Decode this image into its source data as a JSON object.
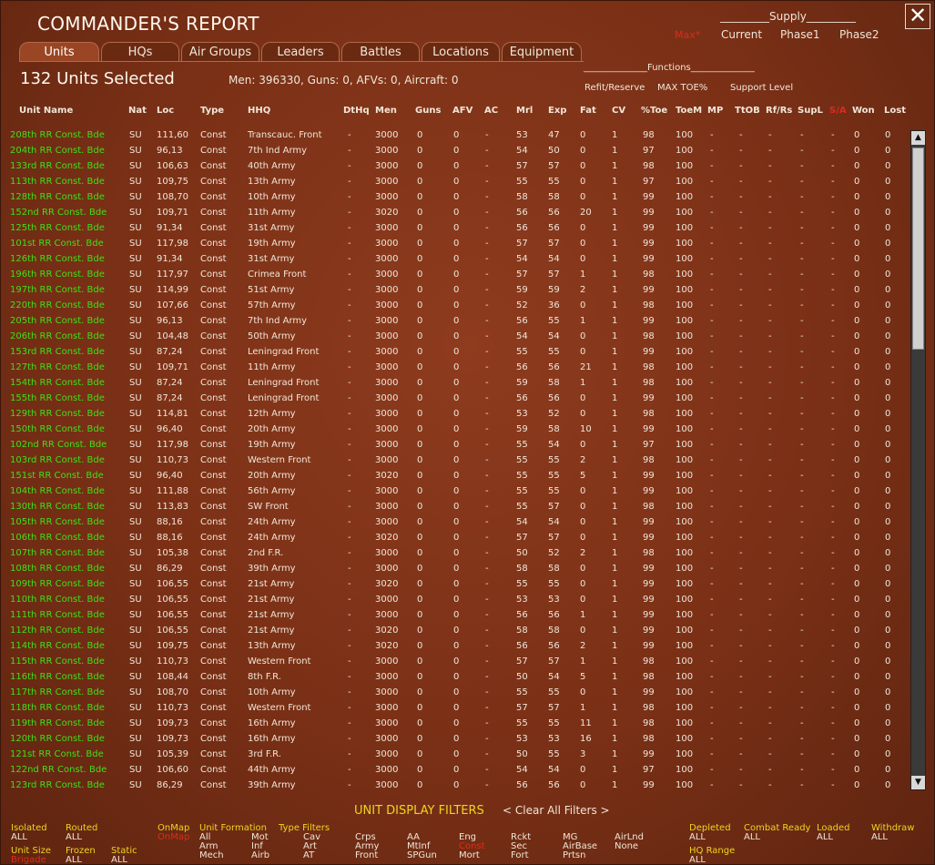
{
  "window": {
    "title": "COMMANDER'S REPORT",
    "close_glyph": "✕",
    "max_label": "Max*"
  },
  "supply": {
    "header": "_________Supply_________",
    "options": [
      "Current",
      "Phase1",
      "Phase2"
    ]
  },
  "tabs": [
    "Units",
    "HQs",
    "Air Groups",
    "Leaders",
    "Battles",
    "Locations",
    "Equipment"
  ],
  "active_tab": "Units",
  "summary": {
    "units_selected": "132 Units Selected",
    "totals": "Men: 396330, Guns: 0, AFVs: 0, Aircraft: 0"
  },
  "functions": {
    "header": "______________Functions______________",
    "options": [
      "Refit/Reserve",
      "MAX TOE%",
      "Support Level"
    ]
  },
  "columns": [
    "Unit Name",
    "Nat",
    "Loc",
    "Type",
    "HHQ",
    "DtHq",
    "Men",
    "Guns",
    "AFV",
    "AC",
    "Mrl",
    "Exp",
    "Fat",
    "CV",
    "%Toe",
    "ToeM",
    "MP",
    "TtOB",
    "Rf/Rs",
    "SupL",
    "S/A",
    "Won",
    "Lost"
  ],
  "rows": [
    [
      "208th RR Const. Bde",
      "SU",
      "111,60",
      "Const",
      "Transcauc. Front",
      "-",
      "3000",
      "0",
      "0",
      "-",
      "53",
      "47",
      "0",
      "1",
      "98",
      "100",
      "-",
      "-",
      "-",
      "-",
      "-",
      "0",
      "0"
    ],
    [
      "204th RR Const. Bde",
      "SU",
      "96,13",
      "Const",
      "7th Ind Army",
      "-",
      "3000",
      "0",
      "0",
      "-",
      "54",
      "50",
      "0",
      "1",
      "97",
      "100",
      "-",
      "-",
      "-",
      "-",
      "-",
      "0",
      "0"
    ],
    [
      "133rd RR Const. Bde",
      "SU",
      "106,63",
      "Const",
      "40th Army",
      "-",
      "3000",
      "0",
      "0",
      "-",
      "57",
      "57",
      "0",
      "1",
      "98",
      "100",
      "-",
      "-",
      "-",
      "-",
      "-",
      "0",
      "0"
    ],
    [
      "113th RR Const. Bde",
      "SU",
      "109,75",
      "Const",
      "13th Army",
      "-",
      "3000",
      "0",
      "0",
      "-",
      "55",
      "55",
      "0",
      "1",
      "97",
      "100",
      "-",
      "-",
      "-",
      "-",
      "-",
      "0",
      "0"
    ],
    [
      "128th RR Const. Bde",
      "SU",
      "108,70",
      "Const",
      "10th Army",
      "-",
      "3000",
      "0",
      "0",
      "-",
      "58",
      "58",
      "0",
      "1",
      "99",
      "100",
      "-",
      "-",
      "-",
      "-",
      "-",
      "0",
      "0"
    ],
    [
      "152nd RR Const. Bde",
      "SU",
      "109,71",
      "Const",
      "11th Army",
      "-",
      "3020",
      "0",
      "0",
      "-",
      "56",
      "56",
      "20",
      "1",
      "99",
      "100",
      "-",
      "-",
      "-",
      "-",
      "-",
      "0",
      "0"
    ],
    [
      "125th RR Const. Bde",
      "SU",
      "91,34",
      "Const",
      "31st Army",
      "-",
      "3000",
      "0",
      "0",
      "-",
      "56",
      "56",
      "0",
      "1",
      "99",
      "100",
      "-",
      "-",
      "-",
      "-",
      "-",
      "0",
      "0"
    ],
    [
      "101st RR Const. Bde",
      "SU",
      "117,98",
      "Const",
      "19th Army",
      "-",
      "3000",
      "0",
      "0",
      "-",
      "57",
      "57",
      "0",
      "1",
      "99",
      "100",
      "-",
      "-",
      "-",
      "-",
      "-",
      "0",
      "0"
    ],
    [
      "126th RR Const. Bde",
      "SU",
      "91,34",
      "Const",
      "31st Army",
      "-",
      "3000",
      "0",
      "0",
      "-",
      "54",
      "54",
      "0",
      "1",
      "99",
      "100",
      "-",
      "-",
      "-",
      "-",
      "-",
      "0",
      "0"
    ],
    [
      "196th RR Const. Bde",
      "SU",
      "117,97",
      "Const",
      "Crimea Front",
      "-",
      "3000",
      "0",
      "0",
      "-",
      "57",
      "57",
      "1",
      "1",
      "98",
      "100",
      "-",
      "-",
      "-",
      "-",
      "-",
      "0",
      "0"
    ],
    [
      "197th RR Const. Bde",
      "SU",
      "114,99",
      "Const",
      "51st Army",
      "-",
      "3000",
      "0",
      "0",
      "-",
      "59",
      "59",
      "2",
      "1",
      "99",
      "100",
      "-",
      "-",
      "-",
      "-",
      "-",
      "0",
      "0"
    ],
    [
      "220th RR Const. Bde",
      "SU",
      "107,66",
      "Const",
      "57th Army",
      "-",
      "3000",
      "0",
      "0",
      "-",
      "52",
      "36",
      "0",
      "1",
      "98",
      "100",
      "-",
      "-",
      "-",
      "-",
      "-",
      "0",
      "0"
    ],
    [
      "205th RR Const. Bde",
      "SU",
      "96,13",
      "Const",
      "7th Ind Army",
      "-",
      "3000",
      "0",
      "0",
      "-",
      "56",
      "55",
      "1",
      "1",
      "99",
      "100",
      "-",
      "-",
      "-",
      "-",
      "-",
      "0",
      "0"
    ],
    [
      "206th RR Const. Bde",
      "SU",
      "104,48",
      "Const",
      "50th Army",
      "-",
      "3000",
      "0",
      "0",
      "-",
      "54",
      "54",
      "0",
      "1",
      "98",
      "100",
      "-",
      "-",
      "-",
      "-",
      "-",
      "0",
      "0"
    ],
    [
      "153rd RR Const. Bde",
      "SU",
      "87,24",
      "Const",
      "Leningrad Front",
      "-",
      "3000",
      "0",
      "0",
      "-",
      "55",
      "55",
      "0",
      "1",
      "99",
      "100",
      "-",
      "-",
      "-",
      "-",
      "-",
      "0",
      "0"
    ],
    [
      "127th RR Const. Bde",
      "SU",
      "109,71",
      "Const",
      "11th Army",
      "-",
      "3000",
      "0",
      "0",
      "-",
      "56",
      "56",
      "21",
      "1",
      "98",
      "100",
      "-",
      "-",
      "-",
      "-",
      "-",
      "0",
      "0"
    ],
    [
      "154th RR Const. Bde",
      "SU",
      "87,24",
      "Const",
      "Leningrad Front",
      "-",
      "3000",
      "0",
      "0",
      "-",
      "59",
      "58",
      "1",
      "1",
      "98",
      "100",
      "-",
      "-",
      "-",
      "-",
      "-",
      "0",
      "0"
    ],
    [
      "155th RR Const. Bde",
      "SU",
      "87,24",
      "Const",
      "Leningrad Front",
      "-",
      "3000",
      "0",
      "0",
      "-",
      "56",
      "56",
      "0",
      "1",
      "99",
      "100",
      "-",
      "-",
      "-",
      "-",
      "-",
      "0",
      "0"
    ],
    [
      "129th RR Const. Bde",
      "SU",
      "114,81",
      "Const",
      "12th Army",
      "-",
      "3000",
      "0",
      "0",
      "-",
      "53",
      "52",
      "0",
      "1",
      "98",
      "100",
      "-",
      "-",
      "-",
      "-",
      "-",
      "0",
      "0"
    ],
    [
      "150th RR Const. Bde",
      "SU",
      "96,40",
      "Const",
      "20th Army",
      "-",
      "3000",
      "0",
      "0",
      "-",
      "59",
      "58",
      "10",
      "1",
      "99",
      "100",
      "-",
      "-",
      "-",
      "-",
      "-",
      "0",
      "0"
    ],
    [
      "102nd RR Const. Bde",
      "SU",
      "117,98",
      "Const",
      "19th Army",
      "-",
      "3000",
      "0",
      "0",
      "-",
      "55",
      "54",
      "0",
      "1",
      "97",
      "100",
      "-",
      "-",
      "-",
      "-",
      "-",
      "0",
      "0"
    ],
    [
      "103rd RR Const. Bde",
      "SU",
      "110,73",
      "Const",
      "Western Front",
      "-",
      "3000",
      "0",
      "0",
      "-",
      "55",
      "55",
      "2",
      "1",
      "98",
      "100",
      "-",
      "-",
      "-",
      "-",
      "-",
      "0",
      "0"
    ],
    [
      "151st RR Const. Bde",
      "SU",
      "96,40",
      "Const",
      "20th Army",
      "-",
      "3020",
      "0",
      "0",
      "-",
      "55",
      "55",
      "5",
      "1",
      "99",
      "100",
      "-",
      "-",
      "-",
      "-",
      "-",
      "0",
      "0"
    ],
    [
      "104th RR Const. Bde",
      "SU",
      "111,88",
      "Const",
      "56th Army",
      "-",
      "3000",
      "0",
      "0",
      "-",
      "55",
      "55",
      "0",
      "1",
      "99",
      "100",
      "-",
      "-",
      "-",
      "-",
      "-",
      "0",
      "0"
    ],
    [
      "130th RR Const. Bde",
      "SU",
      "113,83",
      "Const",
      "SW Front",
      "-",
      "3000",
      "0",
      "0",
      "-",
      "55",
      "57",
      "0",
      "1",
      "98",
      "100",
      "-",
      "-",
      "-",
      "-",
      "-",
      "0",
      "0"
    ],
    [
      "105th RR Const. Bde",
      "SU",
      "88,16",
      "Const",
      "24th Army",
      "-",
      "3000",
      "0",
      "0",
      "-",
      "54",
      "54",
      "0",
      "1",
      "99",
      "100",
      "-",
      "-",
      "-",
      "-",
      "-",
      "0",
      "0"
    ],
    [
      "106th RR Const. Bde",
      "SU",
      "88,16",
      "Const",
      "24th Army",
      "-",
      "3020",
      "0",
      "0",
      "-",
      "57",
      "57",
      "0",
      "1",
      "99",
      "100",
      "-",
      "-",
      "-",
      "-",
      "-",
      "0",
      "0"
    ],
    [
      "107th RR Const. Bde",
      "SU",
      "105,38",
      "Const",
      "2nd F.R.",
      "-",
      "3000",
      "0",
      "0",
      "-",
      "50",
      "52",
      "2",
      "1",
      "98",
      "100",
      "-",
      "-",
      "-",
      "-",
      "-",
      "0",
      "0"
    ],
    [
      "108th RR Const. Bde",
      "SU",
      "86,29",
      "Const",
      "39th Army",
      "-",
      "3000",
      "0",
      "0",
      "-",
      "58",
      "58",
      "0",
      "1",
      "99",
      "100",
      "-",
      "-",
      "-",
      "-",
      "-",
      "0",
      "0"
    ],
    [
      "109th RR Const. Bde",
      "SU",
      "106,55",
      "Const",
      "21st Army",
      "-",
      "3020",
      "0",
      "0",
      "-",
      "55",
      "55",
      "0",
      "1",
      "99",
      "100",
      "-",
      "-",
      "-",
      "-",
      "-",
      "0",
      "0"
    ],
    [
      "110th RR Const. Bde",
      "SU",
      "106,55",
      "Const",
      "21st Army",
      "-",
      "3000",
      "0",
      "0",
      "-",
      "53",
      "53",
      "0",
      "1",
      "99",
      "100",
      "-",
      "-",
      "-",
      "-",
      "-",
      "0",
      "0"
    ],
    [
      "111th RR Const. Bde",
      "SU",
      "106,55",
      "Const",
      "21st Army",
      "-",
      "3000",
      "0",
      "0",
      "-",
      "56",
      "56",
      "1",
      "1",
      "99",
      "100",
      "-",
      "-",
      "-",
      "-",
      "-",
      "0",
      "0"
    ],
    [
      "112th RR Const. Bde",
      "SU",
      "106,55",
      "Const",
      "21st Army",
      "-",
      "3020",
      "0",
      "0",
      "-",
      "58",
      "58",
      "0",
      "1",
      "99",
      "100",
      "-",
      "-",
      "-",
      "-",
      "-",
      "0",
      "0"
    ],
    [
      "114th RR Const. Bde",
      "SU",
      "109,75",
      "Const",
      "13th Army",
      "-",
      "3020",
      "0",
      "0",
      "-",
      "56",
      "56",
      "2",
      "1",
      "99",
      "100",
      "-",
      "-",
      "-",
      "-",
      "-",
      "0",
      "0"
    ],
    [
      "115th RR Const. Bde",
      "SU",
      "110,73",
      "Const",
      "Western Front",
      "-",
      "3000",
      "0",
      "0",
      "-",
      "57",
      "57",
      "1",
      "1",
      "98",
      "100",
      "-",
      "-",
      "-",
      "-",
      "-",
      "0",
      "0"
    ],
    [
      "116th RR Const. Bde",
      "SU",
      "108,44",
      "Const",
      "8th F.R.",
      "-",
      "3000",
      "0",
      "0",
      "-",
      "50",
      "54",
      "5",
      "1",
      "98",
      "100",
      "-",
      "-",
      "-",
      "-",
      "-",
      "0",
      "0"
    ],
    [
      "117th RR Const. Bde",
      "SU",
      "108,70",
      "Const",
      "10th Army",
      "-",
      "3000",
      "0",
      "0",
      "-",
      "55",
      "55",
      "0",
      "1",
      "99",
      "100",
      "-",
      "-",
      "-",
      "-",
      "-",
      "0",
      "0"
    ],
    [
      "118th RR Const. Bde",
      "SU",
      "110,73",
      "Const",
      "Western Front",
      "-",
      "3000",
      "0",
      "0",
      "-",
      "57",
      "57",
      "1",
      "1",
      "98",
      "100",
      "-",
      "-",
      "-",
      "-",
      "-",
      "0",
      "0"
    ],
    [
      "119th RR Const. Bde",
      "SU",
      "109,73",
      "Const",
      "16th Army",
      "-",
      "3000",
      "0",
      "0",
      "-",
      "55",
      "55",
      "11",
      "1",
      "98",
      "100",
      "-",
      "-",
      "-",
      "-",
      "-",
      "0",
      "0"
    ],
    [
      "120th RR Const. Bde",
      "SU",
      "109,73",
      "Const",
      "16th Army",
      "-",
      "3000",
      "0",
      "0",
      "-",
      "53",
      "53",
      "16",
      "1",
      "98",
      "100",
      "-",
      "-",
      "-",
      "-",
      "-",
      "0",
      "0"
    ],
    [
      "121st RR Const. Bde",
      "SU",
      "105,39",
      "Const",
      "3rd F.R.",
      "-",
      "3000",
      "0",
      "0",
      "-",
      "50",
      "55",
      "3",
      "1",
      "99",
      "100",
      "-",
      "-",
      "-",
      "-",
      "-",
      "0",
      "0"
    ],
    [
      "122nd RR Const. Bde",
      "SU",
      "106,60",
      "Const",
      "44th Army",
      "-",
      "3000",
      "0",
      "0",
      "-",
      "54",
      "54",
      "0",
      "1",
      "97",
      "100",
      "-",
      "-",
      "-",
      "-",
      "-",
      "0",
      "0"
    ],
    [
      "123rd RR Const. Bde",
      "SU",
      "86,29",
      "Const",
      "39th Army",
      "-",
      "3000",
      "0",
      "0",
      "-",
      "56",
      "56",
      "0",
      "1",
      "99",
      "100",
      "-",
      "-",
      "-",
      "-",
      "-",
      "0",
      "0"
    ]
  ],
  "filters": {
    "title": "UNIT DISPLAY FILTERS",
    "clear": "< Clear All Filters >",
    "items": [
      {
        "t": "Isolated",
        "c": "y"
      },
      {
        "t": "ALL",
        "c": "w"
      },
      {
        "t": "Routed",
        "c": "y"
      },
      {
        "t": "ALL",
        "c": "w"
      },
      {
        "t": "Unit Size",
        "c": "y"
      },
      {
        "t": "Brigade",
        "c": "r"
      },
      {
        "t": "Frozen",
        "c": "y"
      },
      {
        "t": "ALL",
        "c": "w"
      },
      {
        "t": "Static",
        "c": "y"
      },
      {
        "t": "ALL",
        "c": "w"
      },
      {
        "t": "OnMap",
        "c": "y"
      },
      {
        "t": "OnMap",
        "c": "r"
      },
      {
        "t": "Unit Formation",
        "c": "y"
      },
      {
        "t": "All",
        "c": "w"
      },
      {
        "t": "Arm",
        "c": "w"
      },
      {
        "t": "Mech",
        "c": "w"
      },
      {
        "t": "Mot",
        "c": "w"
      },
      {
        "t": "Inf",
        "c": "w"
      },
      {
        "t": "Airb",
        "c": "w"
      },
      {
        "t": "Type Filters",
        "c": "y"
      },
      {
        "t": "Cav",
        "c": "w"
      },
      {
        "t": "Art",
        "c": "w"
      },
      {
        "t": "AT",
        "c": "w"
      },
      {
        "t": "Crps",
        "c": "w"
      },
      {
        "t": "Army",
        "c": "w"
      },
      {
        "t": "Front",
        "c": "w"
      },
      {
        "t": "AA",
        "c": "w"
      },
      {
        "t": "MtInf",
        "c": "w"
      },
      {
        "t": "SPGun",
        "c": "w"
      },
      {
        "t": "Eng",
        "c": "w"
      },
      {
        "t": "Const",
        "c": "r"
      },
      {
        "t": "Mort",
        "c": "w"
      },
      {
        "t": "Rckt",
        "c": "w"
      },
      {
        "t": "Sec",
        "c": "w"
      },
      {
        "t": "Fort",
        "c": "w"
      },
      {
        "t": "MG",
        "c": "w"
      },
      {
        "t": "AirBase",
        "c": "w"
      },
      {
        "t": "Prtsn",
        "c": "w"
      },
      {
        "t": "AirLnd",
        "c": "w"
      },
      {
        "t": "None",
        "c": "w"
      },
      {
        "t": "Depleted",
        "c": "y"
      },
      {
        "t": "ALL",
        "c": "w"
      },
      {
        "t": "HQ Range",
        "c": "y"
      },
      {
        "t": "ALL",
        "c": "w"
      },
      {
        "t": "Combat Ready",
        "c": "y"
      },
      {
        "t": "ALL",
        "c": "w"
      },
      {
        "t": "Loaded",
        "c": "y"
      },
      {
        "t": "ALL",
        "c": "w"
      },
      {
        "t": "Withdraw",
        "c": "y"
      },
      {
        "t": "ALL",
        "c": "w"
      }
    ]
  },
  "colors": {
    "name_green": "#3fe01a",
    "accent_yellow": "#f0d420",
    "alert_red": "#e02a1a",
    "panel_brown": "#7a3016"
  }
}
